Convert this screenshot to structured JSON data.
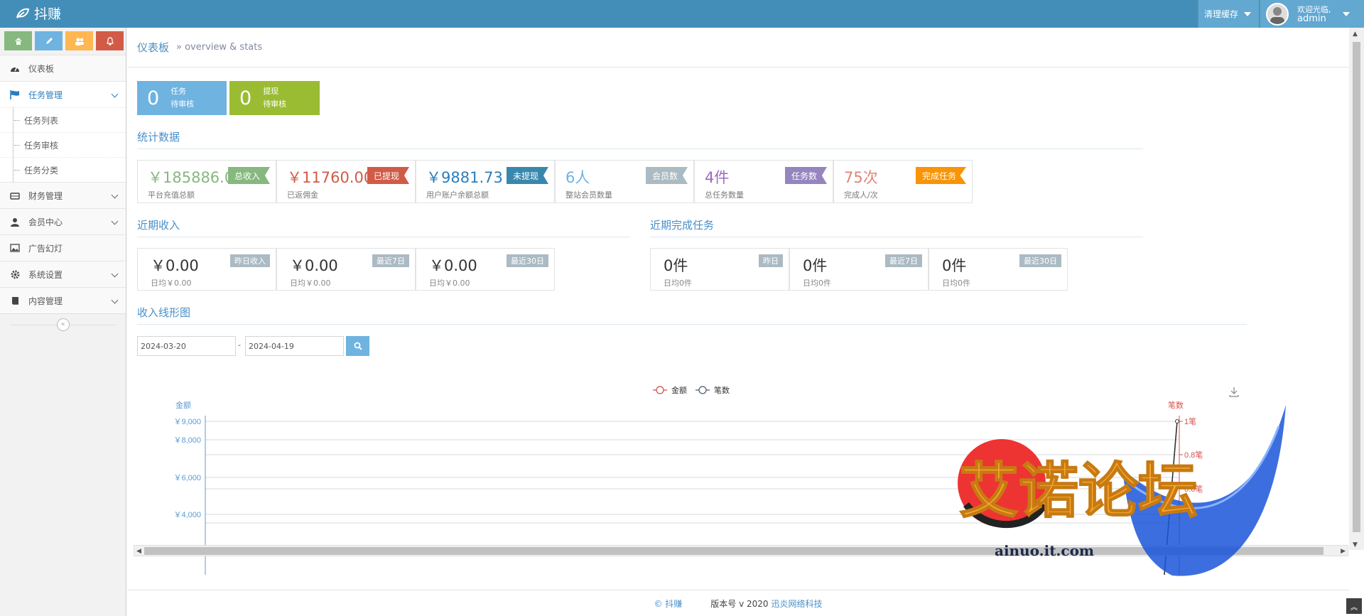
{
  "app": {
    "brand": "抖赚"
  },
  "navbar": {
    "clear_cache": "清理缓存",
    "welcome": "欢迎光临,",
    "username": "admin"
  },
  "sidebar": {
    "items": [
      {
        "label": "仪表板",
        "icon": "dashboard-icon"
      },
      {
        "label": "任务管理",
        "icon": "flag-icon",
        "sub": [
          "任务列表",
          "任务审核",
          "任务分类"
        ]
      },
      {
        "label": "财务管理",
        "icon": "hdd-icon"
      },
      {
        "label": "会员中心",
        "icon": "user-icon"
      },
      {
        "label": "广告幻灯",
        "icon": "picture-icon"
      },
      {
        "label": "系统设置",
        "icon": "cog-icon"
      },
      {
        "label": "内容管理",
        "icon": "book-icon"
      }
    ]
  },
  "breadcrumb": {
    "home": "仪表板",
    "sub": "» overview & stats"
  },
  "tiles": [
    {
      "num": "0",
      "line1": "任务",
      "line2": "待审核",
      "color": "#6fb3e0"
    },
    {
      "num": "0",
      "line1": "提现",
      "line2": "待审核",
      "color": "#9abc32"
    }
  ],
  "sections": {
    "stats": "统计数据",
    "recent_income": "近期收入",
    "recent_tasks": "近期完成任务",
    "chart": "收入线形图"
  },
  "stats": [
    {
      "value": "￥185886.00",
      "label": "平台充值总额",
      "tag": "总收入",
      "color": "#87b87f",
      "tagcolor": "#87b87f"
    },
    {
      "value": "￥11760.00",
      "label": "已返佣金",
      "tag": "已提现",
      "color": "#d15b47",
      "tagcolor": "#d15b47"
    },
    {
      "value": "￥9881.73",
      "label": "用户账户余额总额",
      "tag": "未提现",
      "color": "#2b7dbc",
      "tagcolor": "#3a87ad"
    },
    {
      "value": "6人",
      "label": "整站会员数量",
      "tag": "会员数",
      "color": "#6fb3e0",
      "tagcolor": "#abbac3"
    },
    {
      "value": "4件",
      "label": "总任务数量",
      "tag": "任务数",
      "color": "#a069c3",
      "tagcolor": "#9585bf"
    },
    {
      "value": "75次",
      "label": "完成人/次",
      "tag": "完成任务",
      "color": "#e08374",
      "tagcolor": "#f89406"
    }
  ],
  "recent_income": [
    {
      "value": "￥0.00",
      "sub": "日均￥0.00",
      "tag": "昨日收入"
    },
    {
      "value": "￥0.00",
      "sub": "日均￥0.00",
      "tag": "最近7日"
    },
    {
      "value": "￥0.00",
      "sub": "日均￥0.00",
      "tag": "最近30日"
    }
  ],
  "recent_tasks": [
    {
      "value": "0件",
      "sub": "日均0件",
      "tag": "昨日"
    },
    {
      "value": "0件",
      "sub": "日均0件",
      "tag": "最近7日"
    },
    {
      "value": "0件",
      "sub": "日均0件",
      "tag": "最近30日"
    }
  ],
  "date_range": {
    "start": "2024-03-20",
    "sep": "-",
    "end": "2024-04-19"
  },
  "chart_data": {
    "type": "line",
    "series": [
      {
        "name": "金额",
        "color": "#d14a4a"
      },
      {
        "name": "笔数",
        "color": "#4a5a6a",
        "last_value": 1
      }
    ],
    "left_axis": {
      "label": "金额",
      "ticks": [
        "￥9,000",
        "￥8,000",
        "￥6,000",
        "￥4,000"
      ],
      "color": "#5b9bd5"
    },
    "right_axis": {
      "label": "笔数",
      "ticks": [
        "1笔",
        "0.8笔",
        "0.6笔"
      ],
      "color": "#d9534f"
    }
  },
  "footer": {
    "copyright": "© 抖赚",
    "version": "版本号 v 2020",
    "company": "迅炎网络科技"
  },
  "watermark": {
    "text": "艾诺论坛",
    "url": "ainuo.it.com"
  }
}
